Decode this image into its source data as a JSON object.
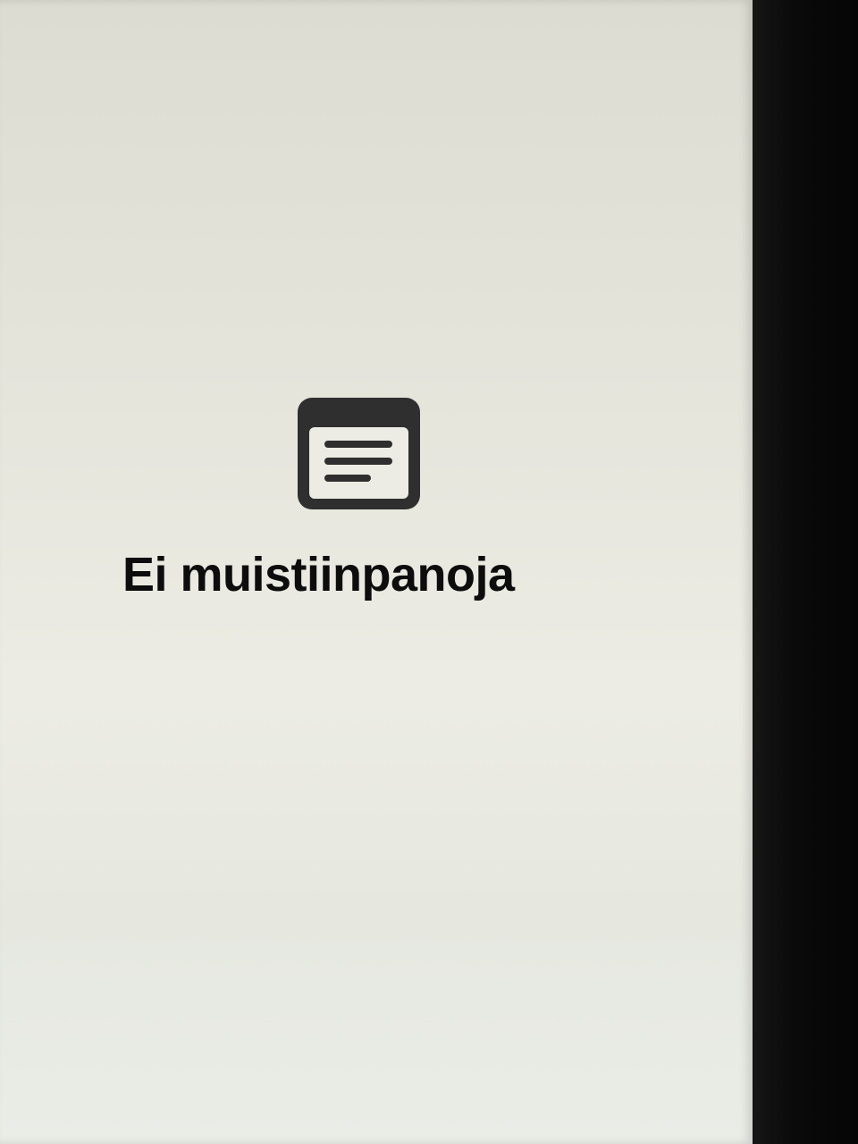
{
  "empty_state": {
    "icon": "notes-icon",
    "title": "Ei muistiinpanoja"
  },
  "colors": {
    "icon": "#2f2f2f",
    "title": "#0d0d0d",
    "bezel": "#0b0b0b"
  }
}
